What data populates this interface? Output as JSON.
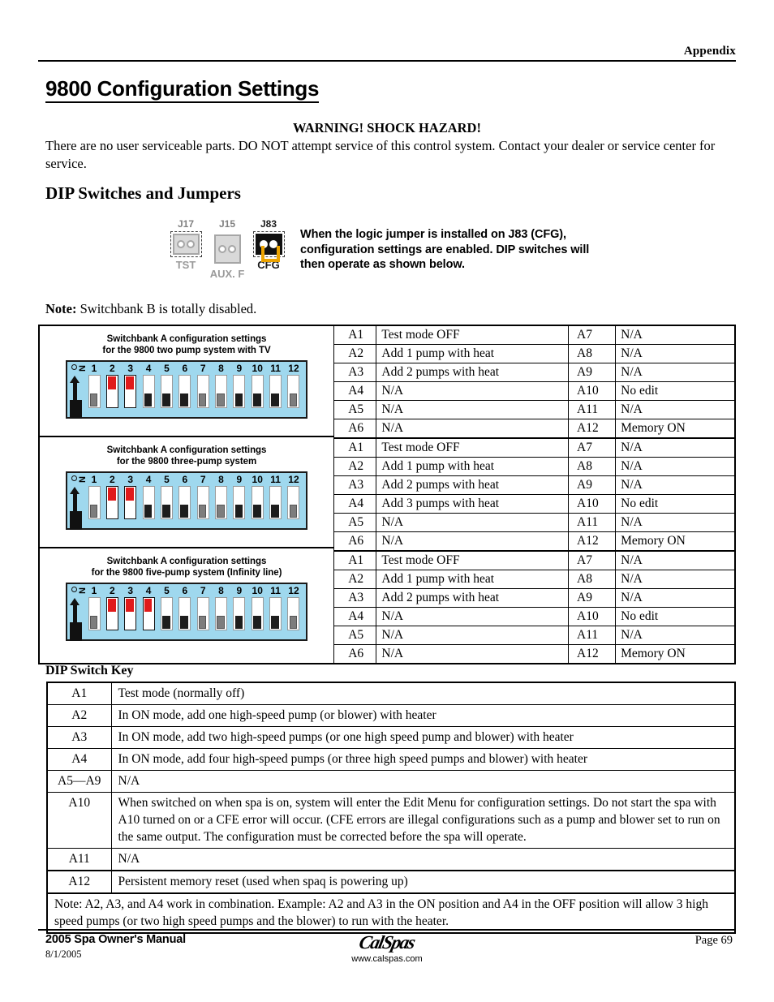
{
  "header": {
    "section": "Appendix"
  },
  "title": "9800 Configuration Settings",
  "warning": {
    "heading": "WARNING!  SHOCK HAZARD!",
    "body": "There are no user serviceable parts. DO NOT attempt service of this control system. Contact your dealer or service center for service."
  },
  "section_heading": "DIP Switches and Jumpers",
  "jumper_figure": {
    "jumpers": [
      {
        "top_label": "J17",
        "bottom_label": "TST",
        "dashed": true,
        "installed": false,
        "style": "gray"
      },
      {
        "top_label": "J15",
        "bottom_label": "AUX. F",
        "dashed": false,
        "installed": false,
        "style": "gray"
      },
      {
        "top_label": "J83",
        "bottom_label": "CFG",
        "dashed": true,
        "installed": true,
        "style": "dark"
      }
    ],
    "note": "When the logic jumper is installed on J83 (CFG), configuration settings are enabled. DIP switches will then operate as shown below.",
    "jumper_color": "#eda400"
  },
  "note_b_prefix": "Note:",
  "note_b_text": " Switchbank B is totally disabled.",
  "switchbank_numbers": [
    "1",
    "2",
    "3",
    "4",
    "5",
    "6",
    "7",
    "8",
    "9",
    "10",
    "11",
    "12"
  ],
  "on_label_o": "O",
  "on_label_n": "N",
  "config_rows": [
    {
      "caption_line1": "Switchbank A configuration settings",
      "caption_line2": "for the 9800 two pump system with TV",
      "switch_states": [
        "off-gray",
        "on",
        "on",
        "off",
        "off",
        "off",
        "off-gray",
        "off-gray",
        "off",
        "off",
        "off",
        "off-gray"
      ],
      "table": [
        {
          "k1": "A1",
          "v1": "Test mode OFF",
          "k2": "A7",
          "v2": "N/A"
        },
        {
          "k1": "A2",
          "v1": "Add 1 pump with heat",
          "k2": "A8",
          "v2": "N/A"
        },
        {
          "k1": "A3",
          "v1": "Add 2 pumps with heat",
          "k2": "A9",
          "v2": "N/A"
        },
        {
          "k1": "A4",
          "v1": "N/A",
          "k2": "A10",
          "v2": "No edit"
        },
        {
          "k1": "A5",
          "v1": "N/A",
          "k2": "A11",
          "v2": "N/A"
        },
        {
          "k1": "A6",
          "v1": "N/A",
          "k2": "A12",
          "v2": "Memory ON"
        }
      ]
    },
    {
      "caption_line1": "Switchbank A configuration settings",
      "caption_line2": "for the 9800 three-pump system",
      "switch_states": [
        "off-gray",
        "on",
        "on",
        "off",
        "off",
        "off",
        "off-gray",
        "off-gray",
        "off",
        "off",
        "off",
        "off-gray"
      ],
      "table": [
        {
          "k1": "A1",
          "v1": "Test mode OFF",
          "k2": "A7",
          "v2": "N/A"
        },
        {
          "k1": "A2",
          "v1": "Add 1 pump with heat",
          "k2": "A8",
          "v2": "N/A"
        },
        {
          "k1": "A3",
          "v1": "Add 2 pumps with heat",
          "k2": "A9",
          "v2": "N/A"
        },
        {
          "k1": "A4",
          "v1": "Add 3 pumps with heat",
          "k2": "A10",
          "v2": "No edit"
        },
        {
          "k1": "A5",
          "v1": "N/A",
          "k2": "A11",
          "v2": "N/A"
        },
        {
          "k1": "A6",
          "v1": "N/A",
          "k2": "A12",
          "v2": "Memory ON"
        }
      ]
    },
    {
      "caption_line1": "Switchbank A configuration settings",
      "caption_line2": "for the 9800 five-pump system (Infinity line)",
      "switch_states": [
        "off-gray",
        "on",
        "on",
        "on",
        "off",
        "off",
        "off-gray",
        "off-gray",
        "off",
        "off",
        "off",
        "off-gray"
      ],
      "table": [
        {
          "k1": "A1",
          "v1": "Test mode OFF",
          "k2": "A7",
          "v2": "N/A"
        },
        {
          "k1": "A2",
          "v1": "Add 1 pump with heat",
          "k2": "A8",
          "v2": "N/A"
        },
        {
          "k1": "A3",
          "v1": "Add 2 pumps with heat",
          "k2": "A9",
          "v2": "N/A"
        },
        {
          "k1": "A4",
          "v1": "N/A",
          "k2": "A10",
          "v2": "No edit"
        },
        {
          "k1": "A5",
          "v1": "N/A",
          "k2": "A11",
          "v2": "N/A"
        },
        {
          "k1": "A6",
          "v1": "N/A",
          "k2": "A12",
          "v2": "Memory ON"
        }
      ]
    }
  ],
  "key_heading": "DIP Switch Key",
  "key_rows": [
    {
      "k": "A1",
      "v": "Test mode (normally off)"
    },
    {
      "k": "A2",
      "v": "In ON mode, add one high-speed pump (or blower) with heater"
    },
    {
      "k": "A3",
      "v": "In ON mode, add two high-speed pumps (or one high speed pump and blower) with heater"
    },
    {
      "k": "A4",
      "v": "In ON mode, add four high-speed pumps (or three high speed pumps and blower) with heater"
    },
    {
      "k": "A5—A9",
      "v": "N/A"
    },
    {
      "k": "A10",
      "v": "When switched on when spa is on, system will enter the Edit Menu for configuration settings. Do not start the spa with A10 turned on or a CFE error will occur. (CFE errors are illegal configurations such as a pump and blower set to run on the same output. The configuration must be corrected before the spa will operate."
    },
    {
      "k": "A11",
      "v": "N/A"
    },
    {
      "k": "A12",
      "v": "Persistent memory reset (used when spaq is powering up)"
    }
  ],
  "key_note": "Note: A2, A3, and A4 work in combination. Example: A2 and A3 in the ON position and A4 in the OFF position will allow 3 high speed pumps (or two high speed pumps and the blower) to run with the heater.",
  "footer": {
    "manual": "2005 Spa Owner's Manual",
    "date": "8/1/2005",
    "logo_text": "CalSpas",
    "url": "www.calspas.com",
    "page": "Page 69"
  }
}
